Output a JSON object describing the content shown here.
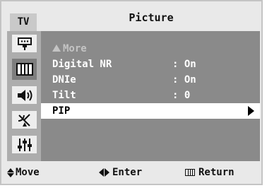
{
  "header": {
    "tv_label": "TV",
    "title": "Picture"
  },
  "sidebar": {
    "items": [
      {
        "icon": "input-icon",
        "active": false
      },
      {
        "icon": "picture-icon",
        "active": true
      },
      {
        "icon": "sound-icon",
        "active": false
      },
      {
        "icon": "channel-icon",
        "active": false
      },
      {
        "icon": "setup-icon",
        "active": false
      }
    ]
  },
  "menu": {
    "more_label": "More",
    "items": [
      {
        "label": "Digital NR",
        "value": ": On"
      },
      {
        "label": "DNIe",
        "value": ": On"
      },
      {
        "label": "Tilt",
        "value": ": 0"
      },
      {
        "label": "PIP",
        "value": ""
      }
    ]
  },
  "footer": {
    "move": "Move",
    "enter": "Enter",
    "return": "Return"
  },
  "colors": {
    "panel": "#8a8a8a",
    "sidebar": "#adadad",
    "selected_row": "#ffffff",
    "background": "#e9e9e9"
  }
}
